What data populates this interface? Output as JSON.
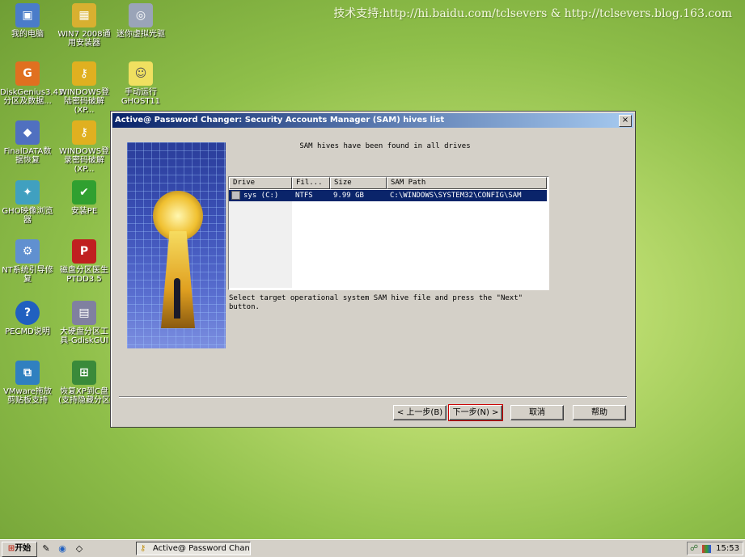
{
  "watermark": "技术支持:http://hi.baidu.com/tclsevers & http://tclsevers.blog.163.com",
  "desktop_icons": [
    {
      "label": "我的电脑",
      "icon": "computer-icon",
      "color": "#4a7cc9"
    },
    {
      "label": "WIN7 2008通用安装器",
      "icon": "installer-icon",
      "color": "#d8b030"
    },
    {
      "label": "迷你虚拟光驱",
      "icon": "virtual-drive-icon",
      "color": "#9aa4b8"
    },
    {
      "label": "DiskGenius3.43分区及数据...",
      "icon": "diskgenius-icon",
      "color": "#e07020"
    },
    {
      "label": "WINDOWS登陆密码破解(XP...",
      "icon": "key-icon",
      "color": "#e0b020"
    },
    {
      "label": "手动运行GHOST11",
      "icon": "ghost-icon",
      "color": "#f0e060"
    },
    {
      "label": "FinalDATA数据恢复",
      "icon": "finaldata-icon",
      "color": "#5070c0"
    },
    {
      "label": "WINDOWS登录密码破解(XP...",
      "icon": "key-icon",
      "color": "#e0b020"
    },
    {
      "label": "GHO映像浏览器",
      "icon": "gho-viewer-icon",
      "color": "#40a0c0"
    },
    {
      "label": "安装PE",
      "icon": "checkmark-icon",
      "color": "#30a030"
    },
    {
      "label": "NT系统引导修复",
      "icon": "nt-repair-icon",
      "color": "#6090d0"
    },
    {
      "label": "磁盘分区医生PTDD3.5",
      "icon": "ptdd-icon",
      "color": "#c02020"
    },
    {
      "label": "PECMD说明",
      "icon": "help-icon",
      "color": "#2060c0"
    },
    {
      "label": "大硬盘分区工具-GdiskGUI",
      "icon": "gdisk-icon",
      "color": "#8080a0"
    },
    {
      "label": "VMware拖放剪贴板支持",
      "icon": "vmware-icon",
      "color": "#3080c0"
    },
    {
      "label": "恢复XP到C盘(支持隐藏分区",
      "icon": "windows-flag-icon",
      "color": "#3a8a3a"
    }
  ],
  "dialog": {
    "title": "Active@ Password Changer: Security Accounts Manager (SAM) hives list",
    "close_label": "×",
    "message_top": "SAM hives have been found in all drives",
    "columns": [
      "Drive",
      "Fil...",
      "Size",
      "SAM Path"
    ],
    "rows": [
      {
        "drive": "sys (C:)",
        "filesystem": "NTFS",
        "size": "9.99 GB",
        "path": "C:\\WINDOWS\\SYSTEM32\\CONFIG\\SAM"
      }
    ],
    "message_bottom": "Select target operational system SAM hive file and press the \"Next\" button.",
    "buttons": {
      "back": "< 上一步(B)",
      "next": "下一步(N) >",
      "cancel": "取消",
      "help": "帮助"
    }
  },
  "taskbar": {
    "start_label": "开始",
    "quicklaunch": [
      "pen-icon",
      "browser-icon",
      "eraser-icon"
    ],
    "task_label": "Active@ Password Chan...",
    "clock": "15:53"
  }
}
